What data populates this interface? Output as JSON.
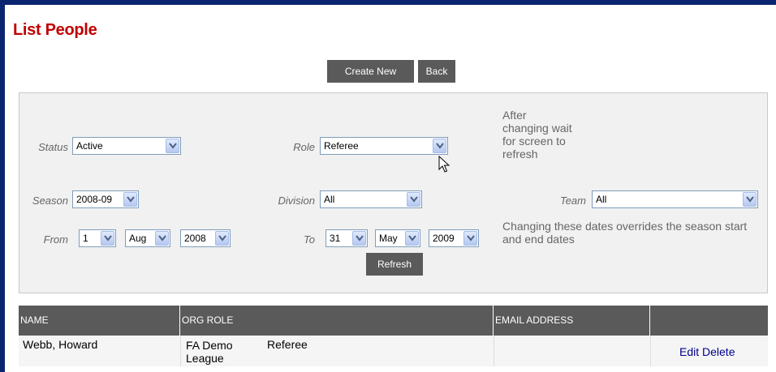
{
  "page": {
    "title": "List People"
  },
  "toolbar": {
    "create_label": "Create New",
    "back_label": "Back"
  },
  "filters": {
    "status": {
      "label": "Status",
      "value": "Active"
    },
    "role": {
      "label": "Role",
      "value": "Referee"
    },
    "role_note": "After changing wait for screen to refresh",
    "season": {
      "label": "Season",
      "value": "2008-09"
    },
    "division": {
      "label": "Division",
      "value": "All"
    },
    "team": {
      "label": "Team",
      "value": "All"
    },
    "from": {
      "label": "From",
      "day": "1",
      "month": "Aug",
      "year": "2008"
    },
    "to": {
      "label": "To",
      "day": "31",
      "month": "May",
      "year": "2009"
    },
    "dates_note": "Changing these dates overrides the season start and end dates",
    "refresh_label": "Refresh"
  },
  "table": {
    "columns": [
      "NAME",
      "ORG ROLE",
      "EMAIL ADDRESS",
      ""
    ],
    "rows": [
      {
        "name": "Webb, Howard",
        "org": "FA Demo League",
        "role": "Referee",
        "email": "",
        "edit": "Edit",
        "delete": "Delete"
      }
    ]
  },
  "colors": {
    "title": "#c00000",
    "button": "#5a5a5a",
    "frame": "#0a2470",
    "link": "#00008b"
  }
}
